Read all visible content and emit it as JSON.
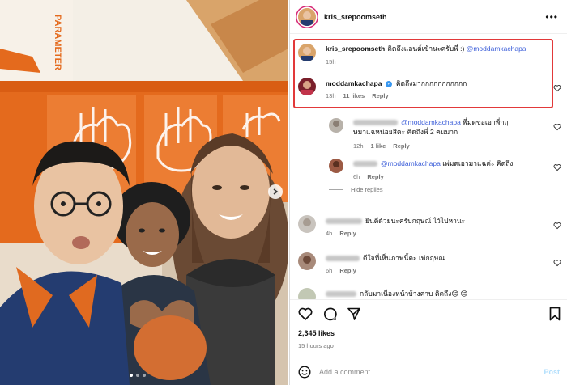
{
  "post": {
    "username": "kris_srepoomseth",
    "likes": "2,345 likes",
    "time_ago": "15 hours ago",
    "photo_sign_text": "PARAMETER",
    "carousel": {
      "total": 3,
      "active": 1
    }
  },
  "comments": [
    {
      "username": "kris_srepoomseth",
      "text": "คิดถึงแอนด์เข้านะครับพี่ :)",
      "mention": "@moddamkachapa",
      "time": "15h"
    },
    {
      "username": "moddamkachapa",
      "verified": true,
      "text": "คิดถึงมากกกกกกกกกกก",
      "time": "13h",
      "likes": "11 likes",
      "reply": "Reply"
    }
  ],
  "replies": [
    {
      "mention": "@moddamkachapa",
      "text_line1": "พี่มดขอเอาพี่กฤ",
      "text_line2": "ษมาแฉหน่อยสิคะ คิดถึงพี่ 2 คนมาก",
      "time": "12h",
      "likes": "1 like",
      "reply": "Reply"
    },
    {
      "mention": "@moddamkachapa",
      "text": "เพ่มดเอามาแฉค่ะ คิดถึง",
      "time": "6h",
      "reply": "Reply"
    }
  ],
  "hide_replies": "Hide replies",
  "more_comments": [
    {
      "text": "ยินดีด้วยนะครับกฤษณ์ ไว้ไปหานะ",
      "time": "4h",
      "reply": "Reply"
    },
    {
      "text": "ดีใจที่เห็นภาพนี้คะ เพ่กฤษณ",
      "time": "6h",
      "reply": "Reply"
    },
    {
      "text": "กลับมาเนื่องหน้าบ้างค่าบ คิดถึง😊 😊"
    }
  ],
  "add_comment": {
    "placeholder": "Add a comment...",
    "post_label": "Post"
  },
  "icons": {
    "like": "heart-icon",
    "comment": "comment-icon",
    "share": "share-icon",
    "save": "bookmark-icon",
    "more": "more-icon",
    "emoji": "emoji-icon",
    "next": "chevron-right-icon"
  },
  "colors": {
    "highlight": "#e2393a",
    "mention": "#3d5fd9",
    "post_disabled": "#b2dffc",
    "verified": "#3897f0"
  }
}
